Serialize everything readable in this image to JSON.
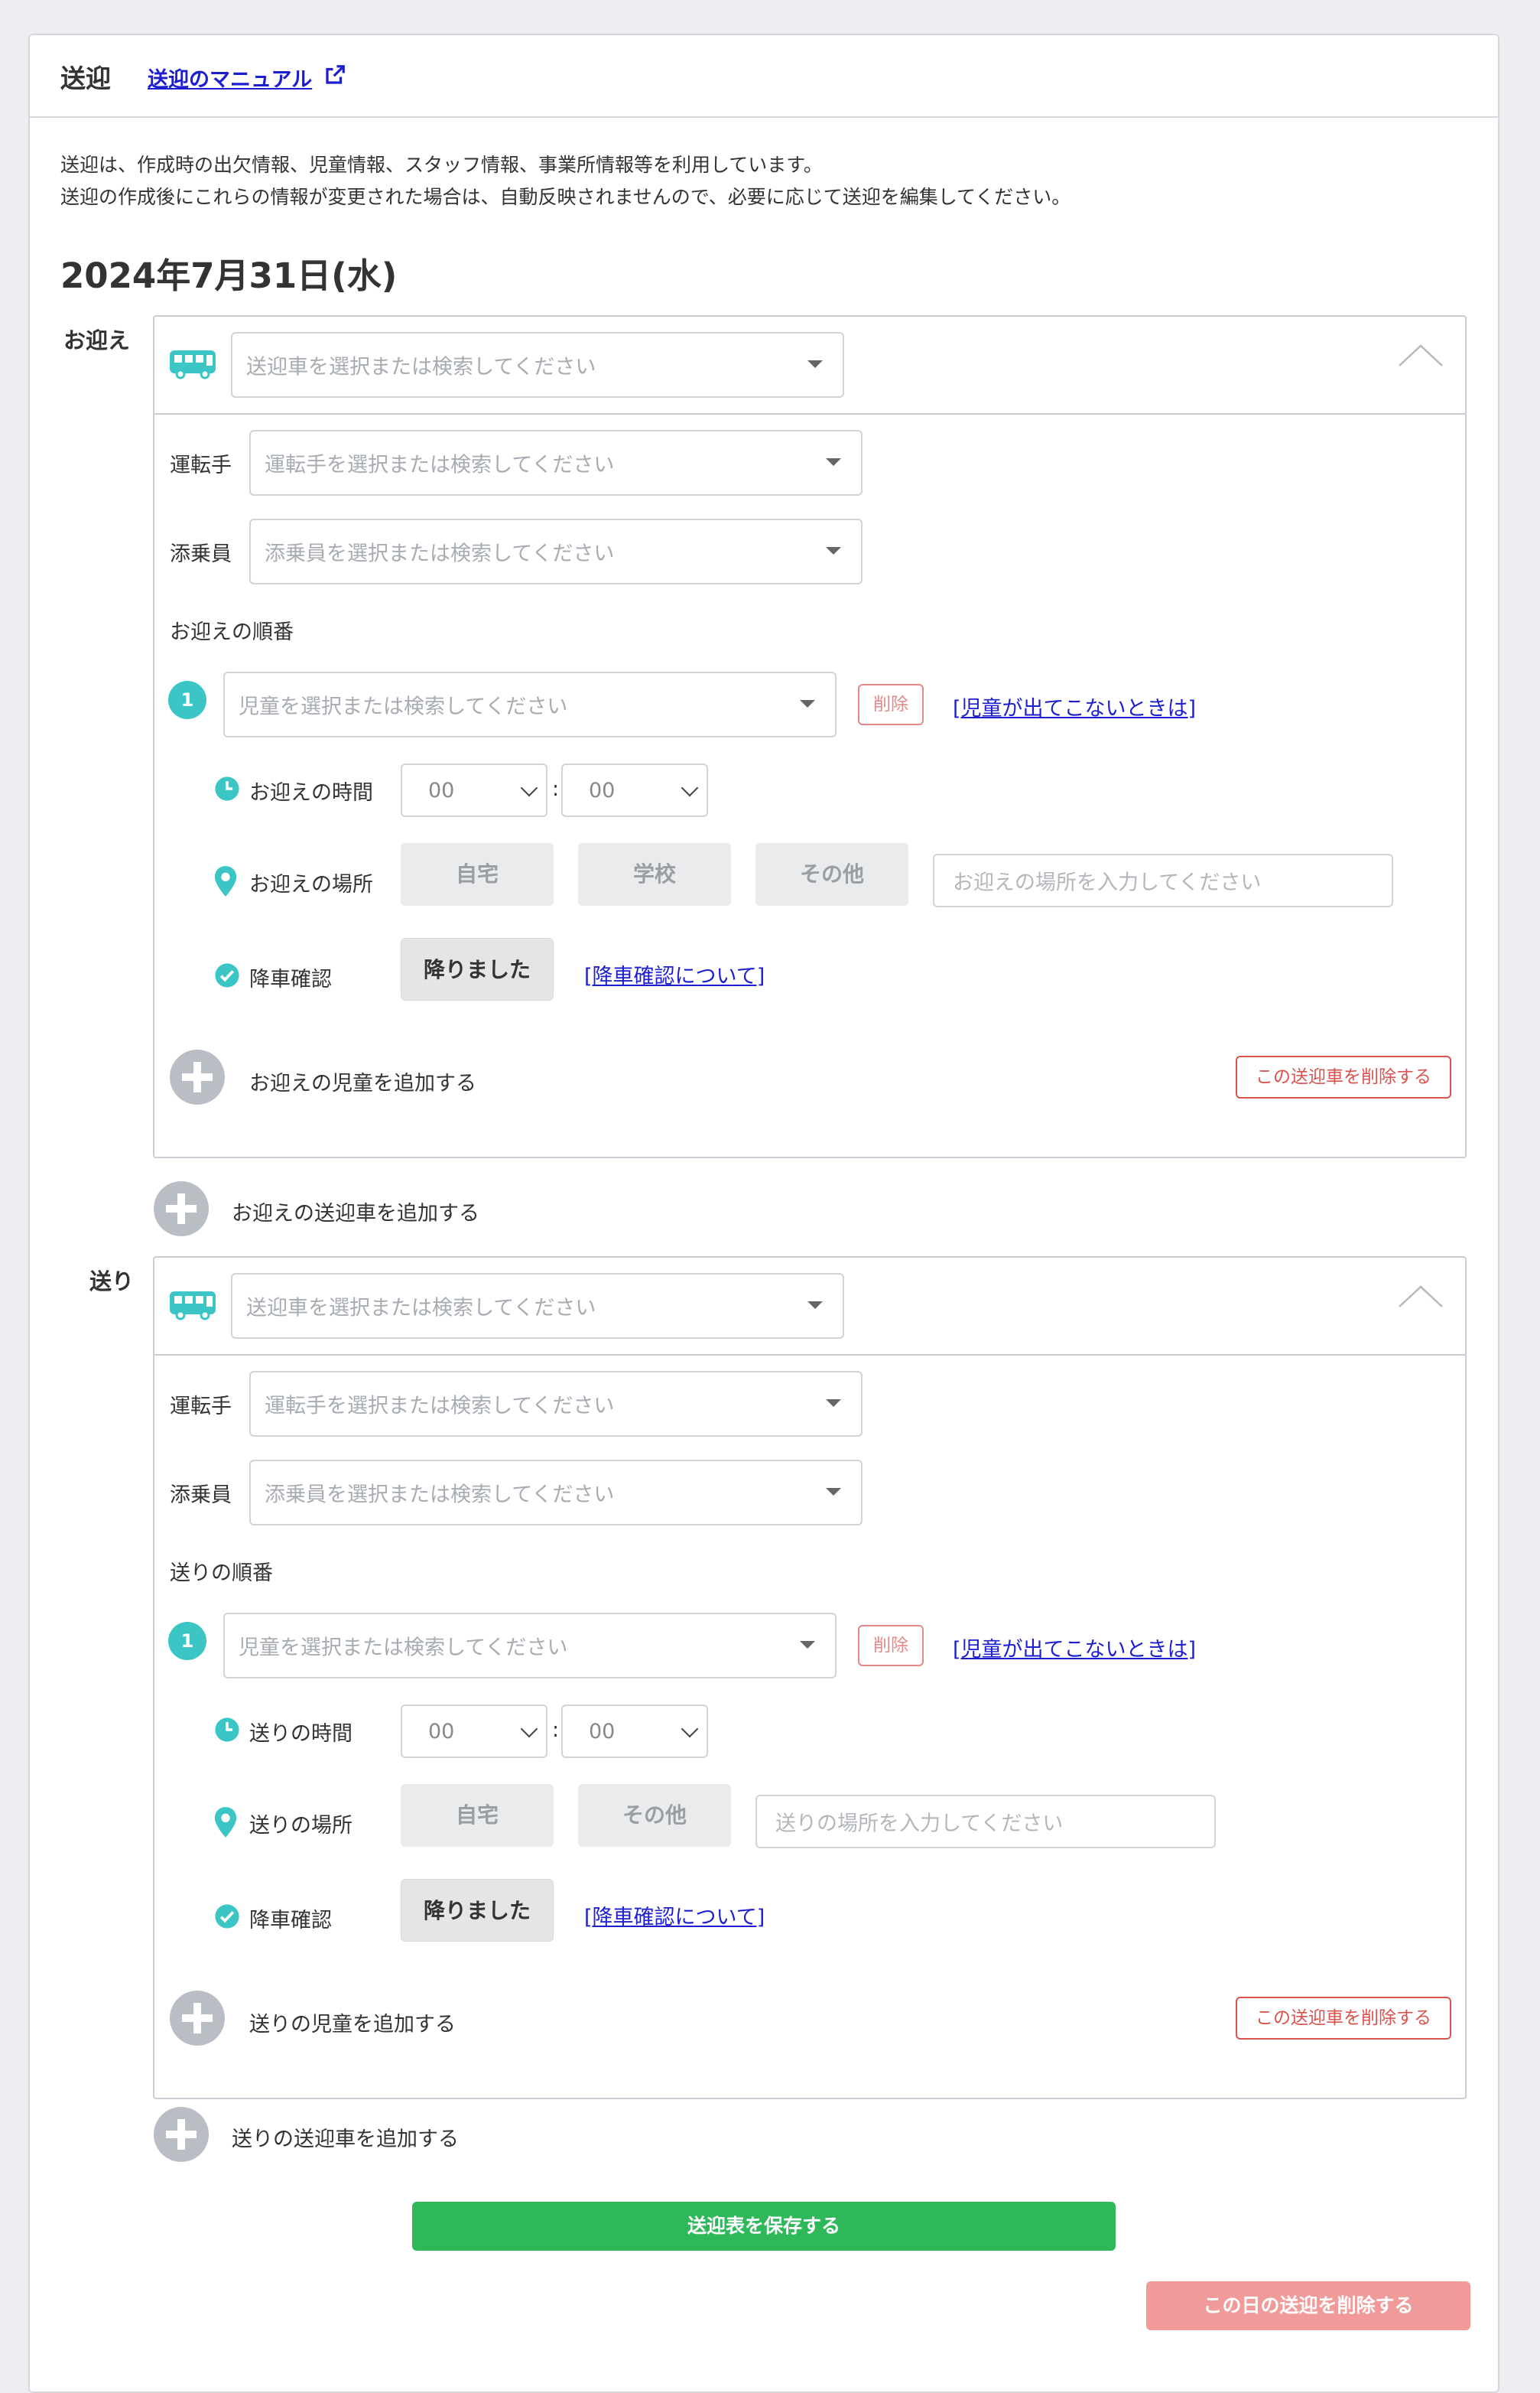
{
  "header": {
    "title": "送迎",
    "manual_link": "送迎のマニュアル"
  },
  "info": {
    "line1": "送迎は、作成時の出欠情報、児童情報、スタッフ情報、事業所情報等を利用しています。",
    "line2": "送迎の作成後にこれらの情報が変更された場合は、自動反映されませんので、必要に応じて送迎を編集してください。"
  },
  "date": "2024年7月31日(水)",
  "pickup": {
    "label": "お迎え",
    "vehicle_placeholder": "送迎車を選択または検索してください",
    "driver_label": "運転手",
    "driver_placeholder": "運転手を選択または検索してください",
    "attendant_label": "添乗員",
    "attendant_placeholder": "添乗員を選択または検索してください",
    "order_label": "お迎えの順番",
    "child": {
      "number": "1",
      "placeholder": "児童を選択または検索してください",
      "delete_label": "削除",
      "help_link": "[児童が出てこないときは]",
      "time_label": "お迎えの時間",
      "hour": "00",
      "minute": "00",
      "place_label": "お迎えの場所",
      "place_options": [
        "自宅",
        "学校",
        "その他"
      ],
      "place_placeholder": "お迎えの場所を入力してください",
      "dropoff_label": "降車確認",
      "dropoff_button": "降りました",
      "dropoff_link": "[降車確認について]"
    },
    "add_child": "お迎えの児童を追加する",
    "delete_vehicle": "この送迎車を削除する",
    "add_vehicle": "お迎えの送迎車を追加する"
  },
  "dropoff": {
    "label": "送り",
    "vehicle_placeholder": "送迎車を選択または検索してください",
    "driver_label": "運転手",
    "driver_placeholder": "運転手を選択または検索してください",
    "attendant_label": "添乗員",
    "attendant_placeholder": "添乗員を選択または検索してください",
    "order_label": "送りの順番",
    "child": {
      "number": "1",
      "placeholder": "児童を選択または検索してください",
      "delete_label": "削除",
      "help_link": "[児童が出てこないときは]",
      "time_label": "送りの時間",
      "hour": "00",
      "minute": "00",
      "place_label": "送りの場所",
      "place_options": [
        "自宅",
        "その他"
      ],
      "place_placeholder": "送りの場所を入力してください",
      "dropoff_label": "降車確認",
      "dropoff_button": "降りました",
      "dropoff_link": "[降車確認について]"
    },
    "add_child": "送りの児童を追加する",
    "delete_vehicle": "この送迎車を削除する",
    "add_vehicle": "送りの送迎車を追加する"
  },
  "actions": {
    "save": "送迎表を保存する",
    "delete_day": "この日の送迎を削除する"
  },
  "colors": {
    "accent": "#3cc5c5",
    "link": "#1d1fcf",
    "save": "#2fb85a",
    "danger": "#d9534f",
    "danger_light": "#f19a9a"
  }
}
